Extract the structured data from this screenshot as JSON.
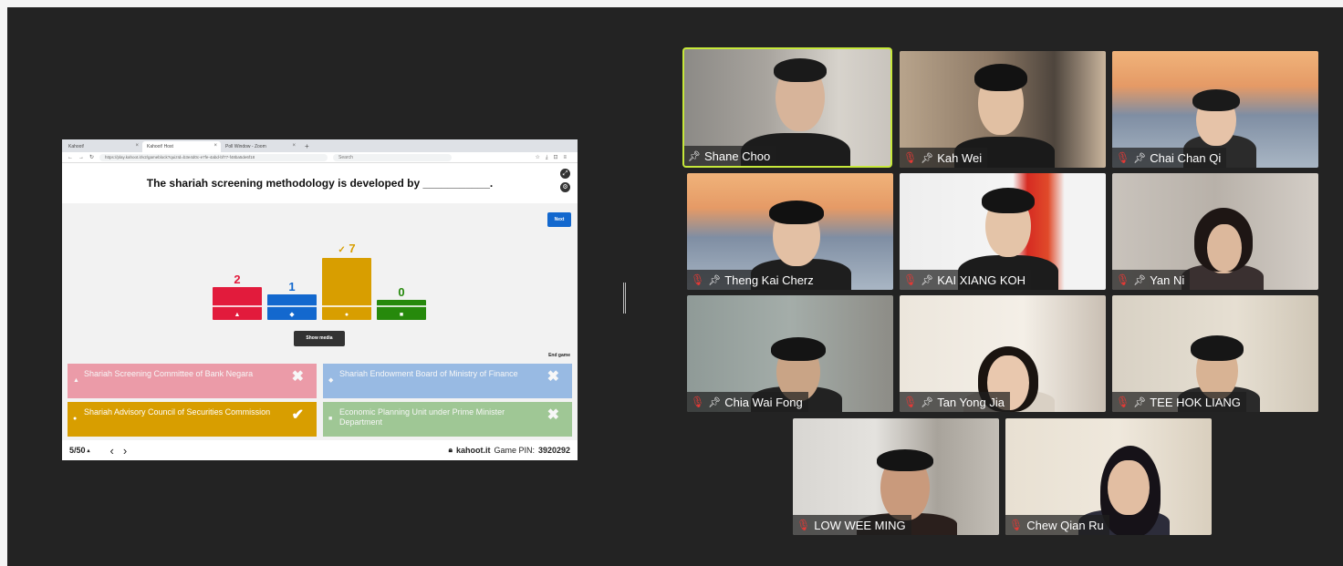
{
  "browser": {
    "tabs": [
      {
        "label": "Kahoot!"
      },
      {
        "label": "Kahoot! Host"
      },
      {
        "label": "Poll Window - Zoom"
      }
    ],
    "url": "https://play.kahoot.it/v2/gameblock?quizId=b3e4d0c-e7fe-4abd-bf77-f48ba5de6f18",
    "search_placeholder": "Search"
  },
  "kahoot": {
    "question": "The shariah screening methodology is developed by ___________.",
    "next_label": "Next",
    "show_media_label": "Show media",
    "end_game_label": "End game",
    "results": [
      {
        "count": "2",
        "color": "#e21b3c",
        "shape": "▲",
        "correct": false
      },
      {
        "count": "1",
        "color": "#1368ce",
        "shape": "◆",
        "correct": false
      },
      {
        "count": "7",
        "color": "#d89e00",
        "shape": "●",
        "correct": true
      },
      {
        "count": "0",
        "color": "#26890c",
        "shape": "■",
        "correct": false
      }
    ],
    "answers": [
      {
        "text": "Shariah Screening Committee of Bank Negara",
        "color": "#e21b3c",
        "shape": "▲",
        "mark": "✖",
        "dim": true
      },
      {
        "text": "Shariah Endowment Board of Ministry of Finance",
        "color": "#1368ce",
        "shape": "◆",
        "mark": "✖",
        "dim": true
      },
      {
        "text": "Shariah Advisory Council of Securities Commission",
        "color": "#d89e00",
        "shape": "●",
        "mark": "✔",
        "dim": false
      },
      {
        "text": "Economic Planning Unit under Prime Minister Department",
        "color": "#26890c",
        "shape": "■",
        "mark": "✖",
        "dim": true
      }
    ],
    "progress": "5/50",
    "site": "kahoot.it",
    "game_pin_label": "Game PIN:",
    "game_pin": "3920292"
  },
  "participants": [
    {
      "name": "Shane Choo",
      "speaker": true,
      "muted": false
    },
    {
      "name": "Kah Wei",
      "speaker": false,
      "muted": true
    },
    {
      "name": "Chai Chan Qi",
      "speaker": false,
      "muted": true
    },
    {
      "name": "Theng Kai Cherz",
      "speaker": false,
      "muted": true
    },
    {
      "name": "KAI XIANG KOH",
      "speaker": false,
      "muted": true
    },
    {
      "name": "Yan Ni",
      "speaker": false,
      "muted": true
    },
    {
      "name": "Chia Wai Fong",
      "speaker": false,
      "muted": true
    },
    {
      "name": "Tan Yong Jia",
      "speaker": false,
      "muted": true
    },
    {
      "name": "TEE HOK LIANG",
      "speaker": false,
      "muted": true
    },
    {
      "name": "LOW WEE MING",
      "speaker": false,
      "muted": true
    },
    {
      "name": "Chew Qian Ru",
      "speaker": false,
      "muted": true
    }
  ],
  "colors": {
    "speaker_outline": "#c6e83a",
    "mic_off": "#e53935",
    "stage_bg": "#232323"
  }
}
